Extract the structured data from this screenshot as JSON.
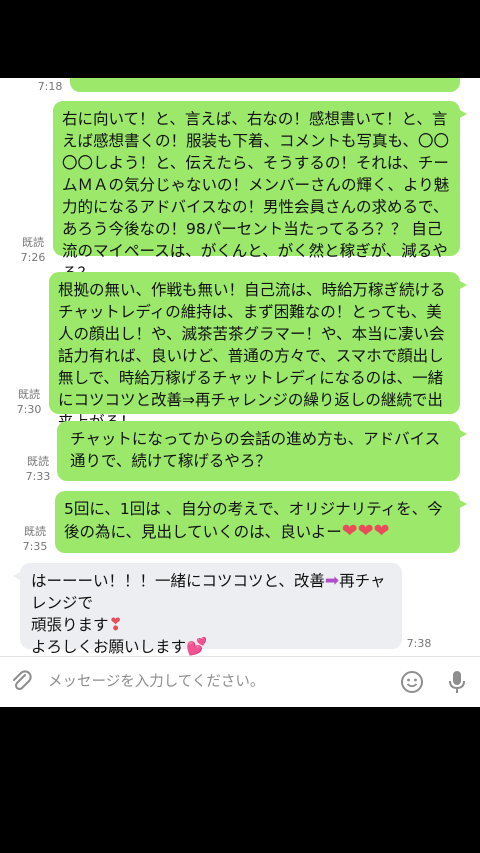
{
  "messages": [
    {
      "id": "m0",
      "type": "outgoing",
      "text": "",
      "read": "",
      "time": "7:18"
    },
    {
      "id": "m1",
      "type": "outgoing",
      "text": "右に向いて！と、言えば、右なの！感想書いて！と、言えば感想書くの！服装も下着、コメントも写真も、〇〇〇〇しよう！と、伝えたら、そうするの！それは、チームＭＡの気分じゃないの！メンバーさんの輝く、より魅力的になるアドバイスなの！男性会員さんの求めるで、あろう今後なの！98パーセント当たってるろ？？ 自己流のマイペースは、がくんと、がく然と稼ぎが、減るやろ？",
      "read": "既読",
      "time": "7:26"
    },
    {
      "id": "m2",
      "type": "outgoing",
      "text": "根拠の無い、作戦も無い！自己流は、時給万稼ぎ続けるチャットレディの維持は、まず困難なの！とっても、美人の顔出し！や、滅茶苦茶グラマー！や、本当に凄い会話力有れば、良いけど、普通の方々で、スマホで顔出し無しで、時給万稼げるチャットレディになるのは、一緒にコツコツと改善⇒再チャレンジの繰り返しの継続で出来上がる！",
      "read": "既読",
      "time": "7:30"
    },
    {
      "id": "m3",
      "type": "outgoing",
      "text": "チャットになってからの会話の進め方も、アドバイス通りで、続けて稼げるやろ？",
      "read": "既読",
      "time": "7:33"
    },
    {
      "id": "m4",
      "type": "outgoing",
      "text": "5回に、1回は 、自分の考えで、オリジナリティを、今後の為に、見出していくのは、良いよー",
      "read": "既読",
      "time": "7:35"
    },
    {
      "id": "m5",
      "type": "incoming",
      "text_a": "はーーーい！！！一緒にコツコツと、改善",
      "text_b": "再チャレンジで",
      "text_c": "頑張ります",
      "text_d": "よろしくお願いします",
      "time": "7:38"
    }
  ],
  "composer": {
    "placeholder": "メッセージを入力してください。",
    "icons": [
      "paperclip-icon",
      "emoji-icon",
      "microphone-icon"
    ]
  },
  "colors": {
    "outgoing_bubble": "#9be86a",
    "incoming_bubble": "#eceef1",
    "heart": "#ea4c5a",
    "arrow": "#b04ec7"
  }
}
